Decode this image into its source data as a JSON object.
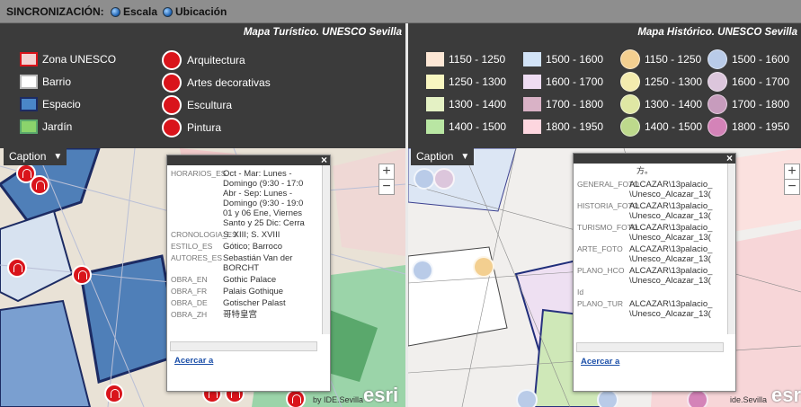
{
  "sync": {
    "title": "SINCRONIZACIÓN:",
    "options": [
      "Escala",
      "Ubicación"
    ]
  },
  "left": {
    "legend_title": "Mapa Turístico. UNESCO Sevilla",
    "col1": [
      {
        "label": "Zona UNESCO",
        "color": "#f3d2d2",
        "icon": "zone-icon"
      },
      {
        "label": "Barrio",
        "color": "#ffffff",
        "icon": "barrio-icon"
      },
      {
        "label": "Espacio",
        "color": "#4a86c8",
        "icon": "espacio-icon"
      },
      {
        "label": "Jardín",
        "color": "#8bd46c",
        "icon": "jardin-icon"
      }
    ],
    "col2": [
      {
        "label": "Arquitectura",
        "icon": "arch-icon"
      },
      {
        "label": "Artes decorativas",
        "icon": "decorative-icon"
      },
      {
        "label": "Escultura",
        "icon": "sculpture-icon"
      },
      {
        "label": "Pintura",
        "icon": "painting-icon"
      }
    ],
    "caption": "Caption",
    "popup": {
      "rows": [
        {
          "k": "HORARIOS_ES",
          "v": "Oct - Mar: Lunes -\nDomingo (9:30 - 17:0\nAbr - Sep: Lunes -\nDomingo (9:30 - 19:0\n01 y 06 Ene, Viernes\nSanto y 25 Dic: Cerra"
        },
        {
          "k": "CRONOLOGIA_ES",
          "v": "S. XIII; S. XVIII"
        },
        {
          "k": "ESTILO_ES",
          "v": "Gótico; Barroco"
        },
        {
          "k": "AUTORES_ES",
          "v": "Sebastián Van der\nBORCHT"
        },
        {
          "k": "OBRA_EN",
          "v": "Gothic Palace"
        },
        {
          "k": "OBRA_FR",
          "v": "Palais Gothique"
        },
        {
          "k": "OBRA_DE",
          "v": "Gotischer Palast"
        },
        {
          "k": "OBRA_ZH",
          "v": "哥特皇宫"
        }
      ],
      "link": "Acercar a"
    },
    "attribution": "by IDE.Sevilla",
    "logo": "esri"
  },
  "right": {
    "legend_title": "Mapa  Histórico. UNESCO Sevilla",
    "ranges": [
      {
        "label": "1150 - 1250",
        "color": "#fde7d5"
      },
      {
        "label": "1250 - 1300",
        "color": "#f8f6c0"
      },
      {
        "label": "1300 - 1400",
        "color": "#e4f1c4"
      },
      {
        "label": "1400 - 1500",
        "color": "#b9e6a3"
      },
      {
        "label": "1500 - 1600",
        "color": "#d2e3f7"
      },
      {
        "label": "1600 - 1700",
        "color": "#eedcf2"
      },
      {
        "label": "1700 - 1800",
        "color": "#d9b2c6"
      },
      {
        "label": "1800 - 1950",
        "color": "#fdd6df"
      }
    ],
    "circles": [
      {
        "label": "1150 - 1250",
        "color": "#f3cf90"
      },
      {
        "label": "1250 - 1300",
        "color": "#f3ebae"
      },
      {
        "label": "1300 - 1400",
        "color": "#dfe7a4"
      },
      {
        "label": "1400 - 1500",
        "color": "#bdd98c"
      },
      {
        "label": "1500 - 1600",
        "color": "#b9cbe8"
      },
      {
        "label": "1600 - 1700",
        "color": "#dcc6dc"
      },
      {
        "label": "1700 - 1800",
        "color": "#c79cbd"
      },
      {
        "label": "1800 - 1950",
        "color": "#d483b8"
      }
    ],
    "caption": "Caption",
    "popup": {
      "top_text": "方。",
      "rows": [
        {
          "k": "GENERAL_FOTO",
          "v": "ALCAZAR\\13palacio_\n\\Unesco_Alcazar_13("
        },
        {
          "k": "HISTORIA_FOTO",
          "v": "ALCAZAR\\13palacio_\n\\Unesco_Alcazar_13("
        },
        {
          "k": "TURISMO_FOTO",
          "v": "ALCAZAR\\13palacio_\n\\Unesco_Alcazar_13("
        },
        {
          "k": "ARTE_FOTO",
          "v": "ALCAZAR\\13palacio_\n\\Unesco_Alcazar_13("
        },
        {
          "k": "PLANO_HCO",
          "v": "ALCAZAR\\13palacio_\n\\Unesco_Alcazar_13("
        },
        {
          "k": "Id",
          "v": ""
        },
        {
          "k": "PLANO_TUR",
          "v": "ALCAZAR\\13palacio_\n\\Unesco_Alcazar_13("
        }
      ],
      "link": "Acercar a"
    },
    "attribution": "ide.Sevilla",
    "logo": "esri"
  },
  "zoom": {
    "in": "+",
    "out": "−"
  },
  "close": "×"
}
